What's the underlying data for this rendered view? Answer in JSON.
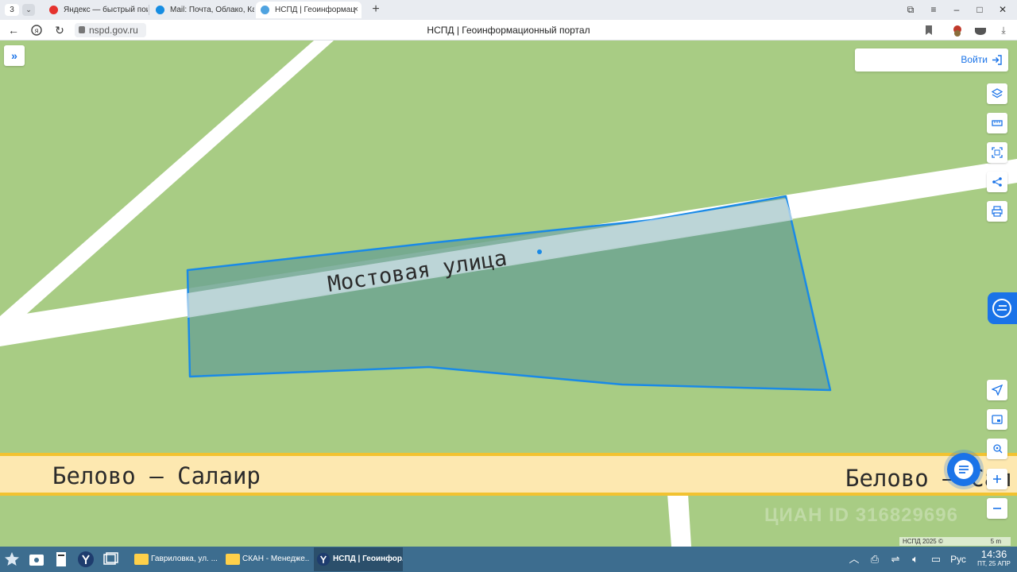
{
  "browser": {
    "tab_count": "3",
    "tabs": [
      {
        "label": "Яндекс — быстрый поис",
        "active": false,
        "icon_color": "#e5322d"
      },
      {
        "label": "Mail: Почта, Облако, Кал",
        "active": false,
        "icon_color": "#168de2"
      },
      {
        "label": "НСПД | Геоинформац",
        "active": true,
        "icon_color": "#4fa3e0"
      }
    ],
    "close_glyph": "×",
    "url": "nspd.gov.ru",
    "page_title": "НСПД | Геоинформационный портал"
  },
  "map": {
    "login_label": "Войти",
    "street_label": "Мостовая улица",
    "road_label_left": "Белово — Салаир",
    "road_label_right": "Белово — Сал",
    "watermark": "ЦИАН ID 316829696",
    "copyright": "НСПД 2025 ©",
    "scale_label": "5 m",
    "tools": [
      "layers-icon",
      "ruler-icon",
      "select-area-icon",
      "share-icon",
      "print-icon",
      "locate-icon",
      "minimap-icon",
      "geo-search-icon",
      "zoom-in-icon",
      "zoom-out-icon"
    ],
    "colors": {
      "background": "#a8cc84",
      "parcel_fill": "#6ea590",
      "parcel_stroke": "#1a8ae6",
      "road_major": "#fde8b0",
      "road_major_border": "#f2c230",
      "accent": "#1a73e8"
    }
  },
  "taskbar": {
    "tasks": [
      {
        "label": "Гавриловка, ул. ..."
      },
      {
        "label": "СКАН - Менедже..."
      },
      {
        "label": "НСПД | Геоинфор..."
      }
    ],
    "language": "Рус",
    "time": "14:36",
    "date": "ПТ, 25 АПР"
  }
}
